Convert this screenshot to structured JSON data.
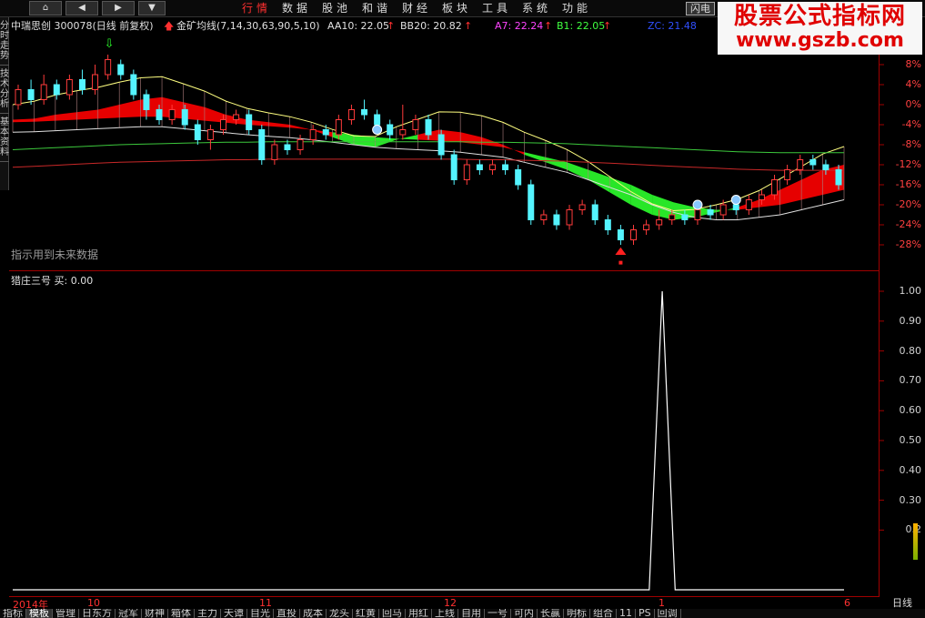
{
  "menubar": {
    "nav": [
      "⌂",
      "◀",
      "▶",
      "▲",
      "▼",
      "≫"
    ],
    "items": [
      {
        "label": "行情",
        "active": true
      },
      {
        "label": "数据",
        "active": false
      },
      {
        "label": "股池",
        "active": false
      },
      {
        "label": "和谐",
        "active": false
      },
      {
        "label": "财经",
        "active": false
      },
      {
        "label": "板块",
        "active": false
      },
      {
        "label": "工具",
        "active": false
      },
      {
        "label": "系统",
        "active": false
      },
      {
        "label": "功能",
        "active": false
      }
    ],
    "flash_label": "闪电"
  },
  "watermark": {
    "title": "股票公式指标网",
    "url": "www.gszb.com"
  },
  "infoline": {
    "stock": "中瑞思创 300078(日线 前复权)",
    "indicator": "金矿均线(7,14,30,63,90,5,10)",
    "aa10": "AA10: 22.05",
    "bb20": "BB20: 20.82",
    "a7": "A7: 22.24",
    "b1": "B1: 22.05",
    "zc": "ZC: 21.48"
  },
  "sidetabs": [
    "分时走势",
    "技术分析",
    "基本资料"
  ],
  "warn_text": "指示用到未来数据",
  "indicator_label": "猎庄三号 买: 0.00",
  "dates": [
    {
      "label": "2014年",
      "x": 0
    },
    {
      "label": "10",
      "x": 0
    },
    {
      "label": "11",
      "x": 0
    },
    {
      "label": "12",
      "x": 0
    },
    {
      "label": "1",
      "x": 0
    },
    {
      "label": "6",
      "x": 0
    }
  ],
  "period": "日线",
  "bottom_tabs": [
    "指标",
    "模板",
    "管理",
    "日东方",
    "冠军",
    "财神",
    "箱体",
    "主力",
    "天谭",
    "目光",
    "直投",
    "成本",
    "龙头",
    "红黄",
    "回马",
    "用红",
    "上线",
    "自用",
    "一号",
    "可内",
    "长赢",
    "明标",
    "组合",
    "11",
    "PS",
    "回调"
  ],
  "active_tab": "模板",
  "colors": {
    "up": "#ff3b3b",
    "down": "#54f4ff",
    "red_ribbon": "#ff0000",
    "green_ribbon": "#2cff2c",
    "ma_yellow": "#ffff80",
    "ma_green": "#3cc83c",
    "ma_red": "#c82828"
  },
  "chart_data": [
    {
      "type": "line",
      "title": "中瑞思创 300078 日线",
      "ylabel": "",
      "ylim": [
        -30,
        10
      ],
      "yticks": [
        "8%",
        "4%",
        "0%",
        "-4%",
        "-8%",
        "-12%",
        "-16%",
        "-20%",
        "-24%",
        "-28%"
      ],
      "x_categories": [
        "2014-10",
        "2014-11",
        "2014-12",
        "2015-01"
      ],
      "series": [
        {
          "name": "",
          "values": [
            -3.0,
            -2.8,
            -2.0,
            -1.5,
            -1.0,
            0.0,
            1.0,
            1.5,
            0.5,
            -0.5,
            -2.0,
            -3.0,
            -3.5,
            -4.0,
            -5.0,
            -6.5,
            -8.0,
            -8.5,
            -7.0,
            -6.0,
            -5.0,
            -5.5,
            -6.5,
            -8.0,
            -10.0,
            -11.5,
            -13.0,
            -15.0,
            -17.5,
            -20.0,
            -22.0,
            -23.0,
            -22.5,
            -21.5,
            -20.5,
            -19.0,
            -17.0,
            -15.0,
            -13.0,
            -12.0
          ]
        },
        {
          "name": "",
          "values": [
            -3.5,
            -3.4,
            -3.2,
            -3.0,
            -2.8,
            -2.6,
            -2.4,
            -2.4,
            -2.8,
            -3.2,
            -3.6,
            -4.0,
            -4.3,
            -4.6,
            -5.0,
            -5.5,
            -6.0,
            -6.5,
            -6.8,
            -7.0,
            -7.2,
            -7.5,
            -8.0,
            -8.5,
            -9.5,
            -10.5,
            -11.5,
            -13.0,
            -14.5,
            -16.0,
            -18.0,
            -19.5,
            -20.5,
            -21.0,
            -21.0,
            -20.5,
            -20.0,
            -19.0,
            -18.0,
            -17.0
          ]
        },
        {
          "name": "",
          "values": [
            -9.0,
            -8.8,
            -8.6,
            -8.4,
            -8.2,
            -8.0,
            -7.9,
            -7.8,
            -7.7,
            -7.6,
            -7.5,
            -7.5,
            -7.4,
            -7.4,
            -7.4,
            -7.4,
            -7.4,
            -7.4,
            -7.4,
            -7.4,
            -7.4,
            -7.4,
            -7.5,
            -7.5,
            -7.6,
            -7.7,
            -7.8,
            -8.0,
            -8.2,
            -8.4,
            -8.6,
            -8.8,
            -9.0,
            -9.2,
            -9.4,
            -9.5,
            -9.6,
            -9.6,
            -9.6,
            -9.6
          ]
        }
      ],
      "candles": [
        {
          "o": 0,
          "c": 3,
          "h": 4,
          "l": -1
        },
        {
          "o": 3,
          "c": 1,
          "h": 5,
          "l": 0
        },
        {
          "o": 1,
          "c": 4,
          "h": 6,
          "l": 0
        },
        {
          "o": 4,
          "c": 2,
          "h": 5,
          "l": 1
        },
        {
          "o": 2,
          "c": 5,
          "h": 6,
          "l": 1
        },
        {
          "o": 5,
          "c": 3,
          "h": 7,
          "l": 2
        },
        {
          "o": 3,
          "c": 6,
          "h": 8,
          "l": 2
        },
        {
          "o": 6,
          "c": 9,
          "h": 10,
          "l": 5
        },
        {
          "o": 8,
          "c": 6,
          "h": 9,
          "l": 5
        },
        {
          "o": 6,
          "c": 2,
          "h": 7,
          "l": 1
        },
        {
          "o": 2,
          "c": -1,
          "h": 3,
          "l": -3
        },
        {
          "o": -1,
          "c": -3,
          "h": 0,
          "l": -4
        },
        {
          "o": -3,
          "c": -1,
          "h": 0,
          "l": -4
        },
        {
          "o": -1,
          "c": -4,
          "h": 0,
          "l": -5
        },
        {
          "o": -4,
          "c": -7,
          "h": -3,
          "l": -8
        },
        {
          "o": -7,
          "c": -5,
          "h": -4,
          "l": -9
        },
        {
          "o": -5,
          "c": -3,
          "h": -2,
          "l": -6
        },
        {
          "o": -3,
          "c": -2,
          "h": -1,
          "l": -4
        },
        {
          "o": -2,
          "c": -5,
          "h": -1,
          "l": -6
        },
        {
          "o": -5,
          "c": -11,
          "h": -4,
          "l": -12
        },
        {
          "o": -11,
          "c": -8,
          "h": -7,
          "l": -12
        },
        {
          "o": -8,
          "c": -9,
          "h": -7,
          "l": -10
        },
        {
          "o": -9,
          "c": -7,
          "h": -6,
          "l": -10
        },
        {
          "o": -7,
          "c": -5,
          "h": -4,
          "l": -8
        },
        {
          "o": -5,
          "c": -6,
          "h": -4,
          "l": -7
        },
        {
          "o": -6,
          "c": -3,
          "h": -2,
          "l": -7
        },
        {
          "o": -3,
          "c": -1,
          "h": 0,
          "l": -4
        },
        {
          "o": -1,
          "c": -2,
          "h": 1,
          "l": -3
        },
        {
          "o": -2,
          "c": -4,
          "h": -1,
          "l": -5
        },
        {
          "o": -4,
          "c": -6,
          "h": -3,
          "l": -7
        },
        {
          "o": -6,
          "c": -5,
          "h": 0,
          "l": -7
        },
        {
          "o": -5,
          "c": -3,
          "h": -2,
          "l": -6
        },
        {
          "o": -3,
          "c": -6,
          "h": -2,
          "l": -7
        },
        {
          "o": -6,
          "c": -10,
          "h": -5,
          "l": -11
        },
        {
          "o": -10,
          "c": -15,
          "h": -9,
          "l": -16
        },
        {
          "o": -15,
          "c": -12,
          "h": -11,
          "l": -16
        },
        {
          "o": -12,
          "c": -13,
          "h": -11,
          "l": -14
        },
        {
          "o": -13,
          "c": -12,
          "h": -11,
          "l": -14
        },
        {
          "o": -12,
          "c": -13,
          "h": -11,
          "l": -14
        },
        {
          "o": -13,
          "c": -16,
          "h": -12,
          "l": -17
        },
        {
          "o": -16,
          "c": -23,
          "h": -15,
          "l": -24
        },
        {
          "o": -23,
          "c": -22,
          "h": -21,
          "l": -24
        },
        {
          "o": -22,
          "c": -24,
          "h": -21,
          "l": -25
        },
        {
          "o": -24,
          "c": -21,
          "h": -20,
          "l": -25
        },
        {
          "o": -21,
          "c": -20,
          "h": -19,
          "l": -22
        },
        {
          "o": -20,
          "c": -23,
          "h": -19,
          "l": -24
        },
        {
          "o": -23,
          "c": -25,
          "h": -22,
          "l": -26
        },
        {
          "o": -25,
          "c": -27,
          "h": -24,
          "l": -28
        },
        {
          "o": -27,
          "c": -25,
          "h": -24,
          "l": -28
        },
        {
          "o": -25,
          "c": -24,
          "h": -23,
          "l": -26
        },
        {
          "o": -24,
          "c": -23,
          "h": -21,
          "l": -25
        },
        {
          "o": -23,
          "c": -22,
          "h": -21,
          "l": -24
        },
        {
          "o": -22,
          "c": -23,
          "h": -21,
          "l": -24
        },
        {
          "o": -23,
          "c": -21,
          "h": -20,
          "l": -24
        },
        {
          "o": -21,
          "c": -22,
          "h": -20,
          "l": -23
        },
        {
          "o": -22,
          "c": -20,
          "h": -19,
          "l": -23
        },
        {
          "o": -20,
          "c": -21,
          "h": -19,
          "l": -22
        },
        {
          "o": -21,
          "c": -19,
          "h": -18,
          "l": -22
        },
        {
          "o": -19,
          "c": -18,
          "h": -17,
          "l": -20
        },
        {
          "o": -18,
          "c": -15,
          "h": -14,
          "l": -19
        },
        {
          "o": -15,
          "c": -13,
          "h": -12,
          "l": -16
        },
        {
          "o": -13,
          "c": -11,
          "h": -10,
          "l": -14
        },
        {
          "o": -11,
          "c": -12,
          "h": -10,
          "l": -13
        },
        {
          "o": -12,
          "c": -13,
          "h": -11,
          "l": -14
        },
        {
          "o": -13,
          "c": -16,
          "h": -12,
          "l": -17
        }
      ]
    },
    {
      "type": "line",
      "title": "猎庄三号",
      "ylim": [
        0,
        1
      ],
      "yticks": [
        "1.00",
        "0.90",
        "0.80",
        "0.70",
        "0.60",
        "0.50",
        "0.40",
        "0.30",
        "0.2"
      ],
      "series": [
        {
          "name": "买",
          "values": [
            0,
            0,
            0,
            0,
            0,
            0,
            0,
            0,
            0,
            0,
            0,
            0,
            0,
            0,
            0,
            0,
            0,
            0,
            0,
            0,
            0,
            0,
            0,
            0,
            0,
            0,
            0,
            0,
            0,
            0,
            0,
            0,
            0,
            0,
            0,
            0,
            0,
            0,
            0,
            0,
            0,
            0,
            0,
            0,
            0,
            0,
            0,
            0,
            0,
            0,
            1,
            0,
            0,
            0,
            0,
            0,
            0,
            0,
            0,
            0,
            0,
            0,
            0,
            0,
            0
          ]
        }
      ]
    }
  ]
}
